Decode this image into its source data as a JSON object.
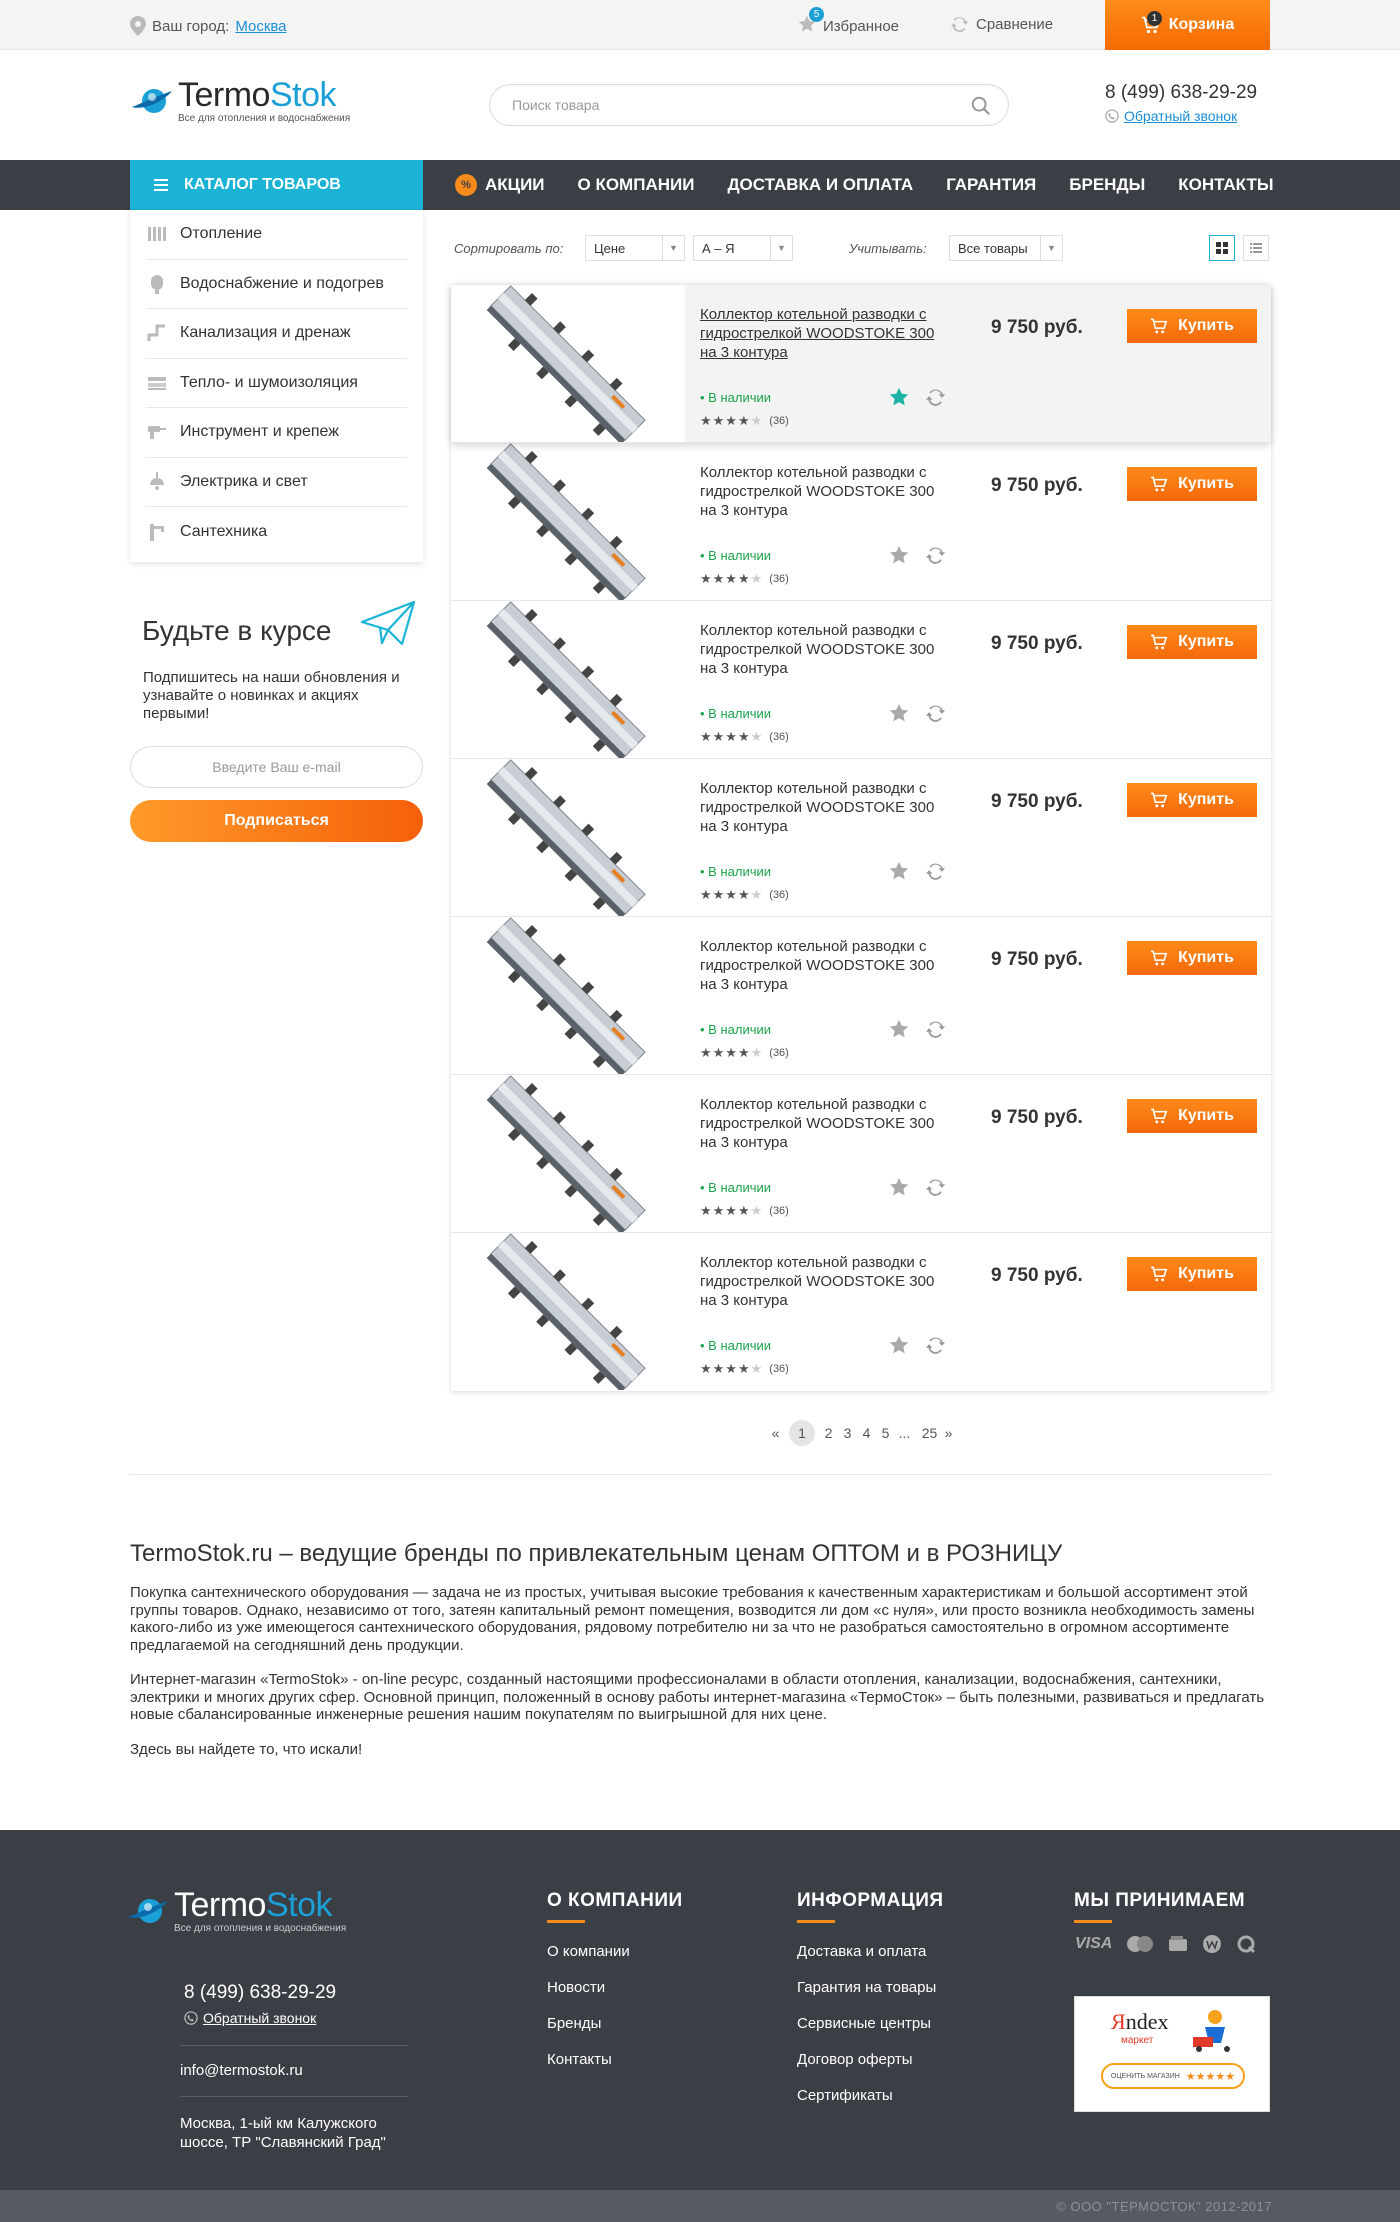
{
  "topbar": {
    "city_label": "Ваш город:",
    "city_value": "Москва",
    "favorites_label": "Избранное",
    "favorites_count": "5",
    "compare_label": "Сравнение",
    "cart_label": "Корзина",
    "cart_count": "1"
  },
  "header": {
    "logo_main_a": "Termo",
    "logo_main_b": "Stok",
    "logo_sub": "Все для отопления и водоснабжения",
    "search_placeholder": "Поиск товара",
    "phone": "8 (499) 638-29-29",
    "callback": "Обратный звонок"
  },
  "nav": {
    "catalog": "КАТАЛОГ ТОВАРОВ",
    "promo_icon_text": "%",
    "items": [
      "АКЦИИ",
      "О КОМПАНИИ",
      "ДОСТАВКА И ОПЛАТА",
      "ГАРАНТИЯ",
      "БРЕНДЫ",
      "КОНТАКТЫ"
    ]
  },
  "categories": [
    {
      "label": "Отопление",
      "icon": "radiator-icon"
    },
    {
      "label": "Водоснабжение и подогрев",
      "icon": "water-heater-icon"
    },
    {
      "label": "Канализация и дренаж",
      "icon": "pipe-icon"
    },
    {
      "label": "Тепло- и шумоизоляция",
      "icon": "insulation-icon"
    },
    {
      "label": "Инструмент и крепеж",
      "icon": "drill-icon"
    },
    {
      "label": "Электрика и свет",
      "icon": "lamp-icon"
    },
    {
      "label": "Сантехника",
      "icon": "faucet-icon"
    }
  ],
  "subscribe": {
    "title": "Будьте в курсе",
    "text": "Подпишитесь на наши обновления и узнавайте о новинках и акциях первыми!",
    "email_placeholder": "Введите Ваш e-mail",
    "button": "Подписаться"
  },
  "toolbar": {
    "sort_label": "Сортировать по:",
    "sort_value": "Цене",
    "order_value": "А – Я",
    "filter_label": "Учитывать:",
    "filter_value": "Все товары"
  },
  "products": [
    {
      "name": "Коллектор котельной разводки с гидрострелкой WOODSTOKE 300 на 3 контура",
      "stock": "В наличии",
      "rating": 4,
      "reviews": "(36)",
      "price": "9 750 руб.",
      "buy": "Купить"
    },
    {
      "name": "Коллектор котельной разводки с гидрострелкой WOODSTOKE 300 на 3 контура",
      "stock": "В наличии",
      "rating": 4,
      "reviews": "(36)",
      "price": "9 750 руб.",
      "buy": "Купить"
    },
    {
      "name": "Коллектор котельной разводки с гидрострелкой WOODSTOKE 300 на 3 контура",
      "stock": "В наличии",
      "rating": 4,
      "reviews": "(36)",
      "price": "9 750 руб.",
      "buy": "Купить"
    },
    {
      "name": "Коллектор котельной разводки с гидрострелкой WOODSTOKE 300 на 3 контура",
      "stock": "В наличии",
      "rating": 4,
      "reviews": "(36)",
      "price": "9 750 руб.",
      "buy": "Купить"
    },
    {
      "name": "Коллектор котельной разводки с гидрострелкой WOODSTOKE 300 на 3 контура",
      "stock": "В наличии",
      "rating": 4,
      "reviews": "(36)",
      "price": "9 750 руб.",
      "buy": "Купить"
    },
    {
      "name": "Коллектор котельной разводки с гидрострелкой WOODSTOKE 300 на 3 контура",
      "stock": "В наличии",
      "rating": 4,
      "reviews": "(36)",
      "price": "9 750 руб.",
      "buy": "Купить"
    },
    {
      "name": "Коллектор котельной разводки с гидрострелкой WOODSTOKE 300 на 3 контура",
      "stock": "В наличии",
      "rating": 4,
      "reviews": "(36)",
      "price": "9 750 руб.",
      "buy": "Купить"
    }
  ],
  "pagination": {
    "prev": "«",
    "pages": [
      "1",
      "2",
      "3",
      "4",
      "5"
    ],
    "ellipsis": "...",
    "last": "25",
    "next": "»",
    "current": "1"
  },
  "seo": {
    "title": "TermoStok.ru – ведущие бренды по привлекательным ценам ОПТОМ и в РОЗНИЦУ",
    "p1": "Покупка сантехнического оборудования — задача не из простых, учитывая высокие требования к качественным характеристикам и большой ассортимент этой группы товаров. Однако, независимо от того, затеян капитальный ремонт помещения, возводится ли дом «с нуля», или просто возникла необходимость замены какого-либо из уже имеющегося сантехнического оборудования, рядовому потребителю ни за что не разобраться самостоятельно в огромном ассортименте предлагаемой на сегодняшний день продукции.",
    "p2": "Интернет-магазин «TermoStok» - on-line ресурс, созданный настоящими профессионалами в области отопления, канализации, водоснабжения, сантехники, электрики и многих других сфер. Основной принцип, положенный в основу работы интернет-магазина «ТермоСток» – быть полезными, развиваться и предлагать новые сбалансированные инженерные решения нашим покупателям по выигрышной для них цене.",
    "p3": "Здесь вы найдете то, что искали!"
  },
  "footer": {
    "phone": "8 (499) 638-29-29",
    "callback": "Обратный звонок",
    "email": "info@termostok.ru",
    "address": "Москва, 1-ый км Калужского шоссе, ТР \"Славянский Град\"",
    "col1_title": "О КОМПАНИИ",
    "col1": [
      "О компании",
      "Новости",
      "Бренды",
      "Контакты"
    ],
    "col2_title": "ИНФОРМАЦИЯ",
    "col2": [
      "Доставка и оплата",
      "Гарантия на товары",
      "Сервисные центры",
      "Договор оферты",
      "Сертификаты"
    ],
    "col3_title": "МЫ ПРИНИМАЕМ",
    "visa": "VISA",
    "ym_logo_y": "Я",
    "ym_logo_rest": "ndex",
    "ym_sub": "маркет",
    "ym_rate": "ОЦЕНИТЬ МАГАЗИН",
    "ym_stars": "★★★★★",
    "copyright": "© ООО \"ТЕРМОСТОК\" 2012-2017"
  },
  "colors": {
    "accent_orange": "#f66a00",
    "accent_blue": "#1ab3d6",
    "nav_dark": "#3a3f45",
    "stock_green": "#1aa34a"
  }
}
